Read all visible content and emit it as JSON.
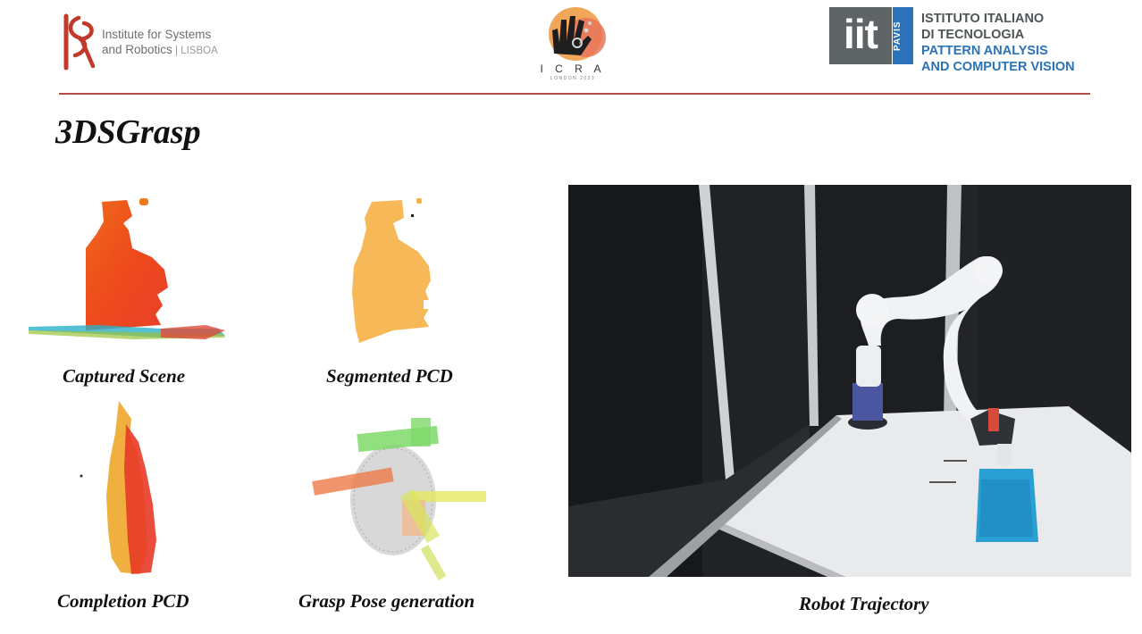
{
  "header": {
    "isr": {
      "line1": "Institute for Systems",
      "line2_main": "and Robotics",
      "line2_sep": " | ",
      "line2_sub": "LISBOA"
    },
    "icra": {
      "name": "I C R A",
      "sub": "LONDON 2023"
    },
    "iit": {
      "mark": "iit",
      "pavis": "PAVIS",
      "line1": "ISTITUTO ITALIANO",
      "line2": "DI TECNOLOGIA",
      "line3": "PATTERN ANALYSIS",
      "line4": "AND COMPUTER VISION"
    }
  },
  "title": "3DSGrasp",
  "captions": {
    "captured": "Captured Scene",
    "segmented": "Segmented PCD",
    "completion": "Completion PCD",
    "grasp": "Grasp Pose generation",
    "robot": "Robot Trajectory"
  },
  "colors": {
    "rule": "#b84a4a",
    "iit_grey": "#5e6366",
    "iit_blue": "#2b73b9"
  }
}
